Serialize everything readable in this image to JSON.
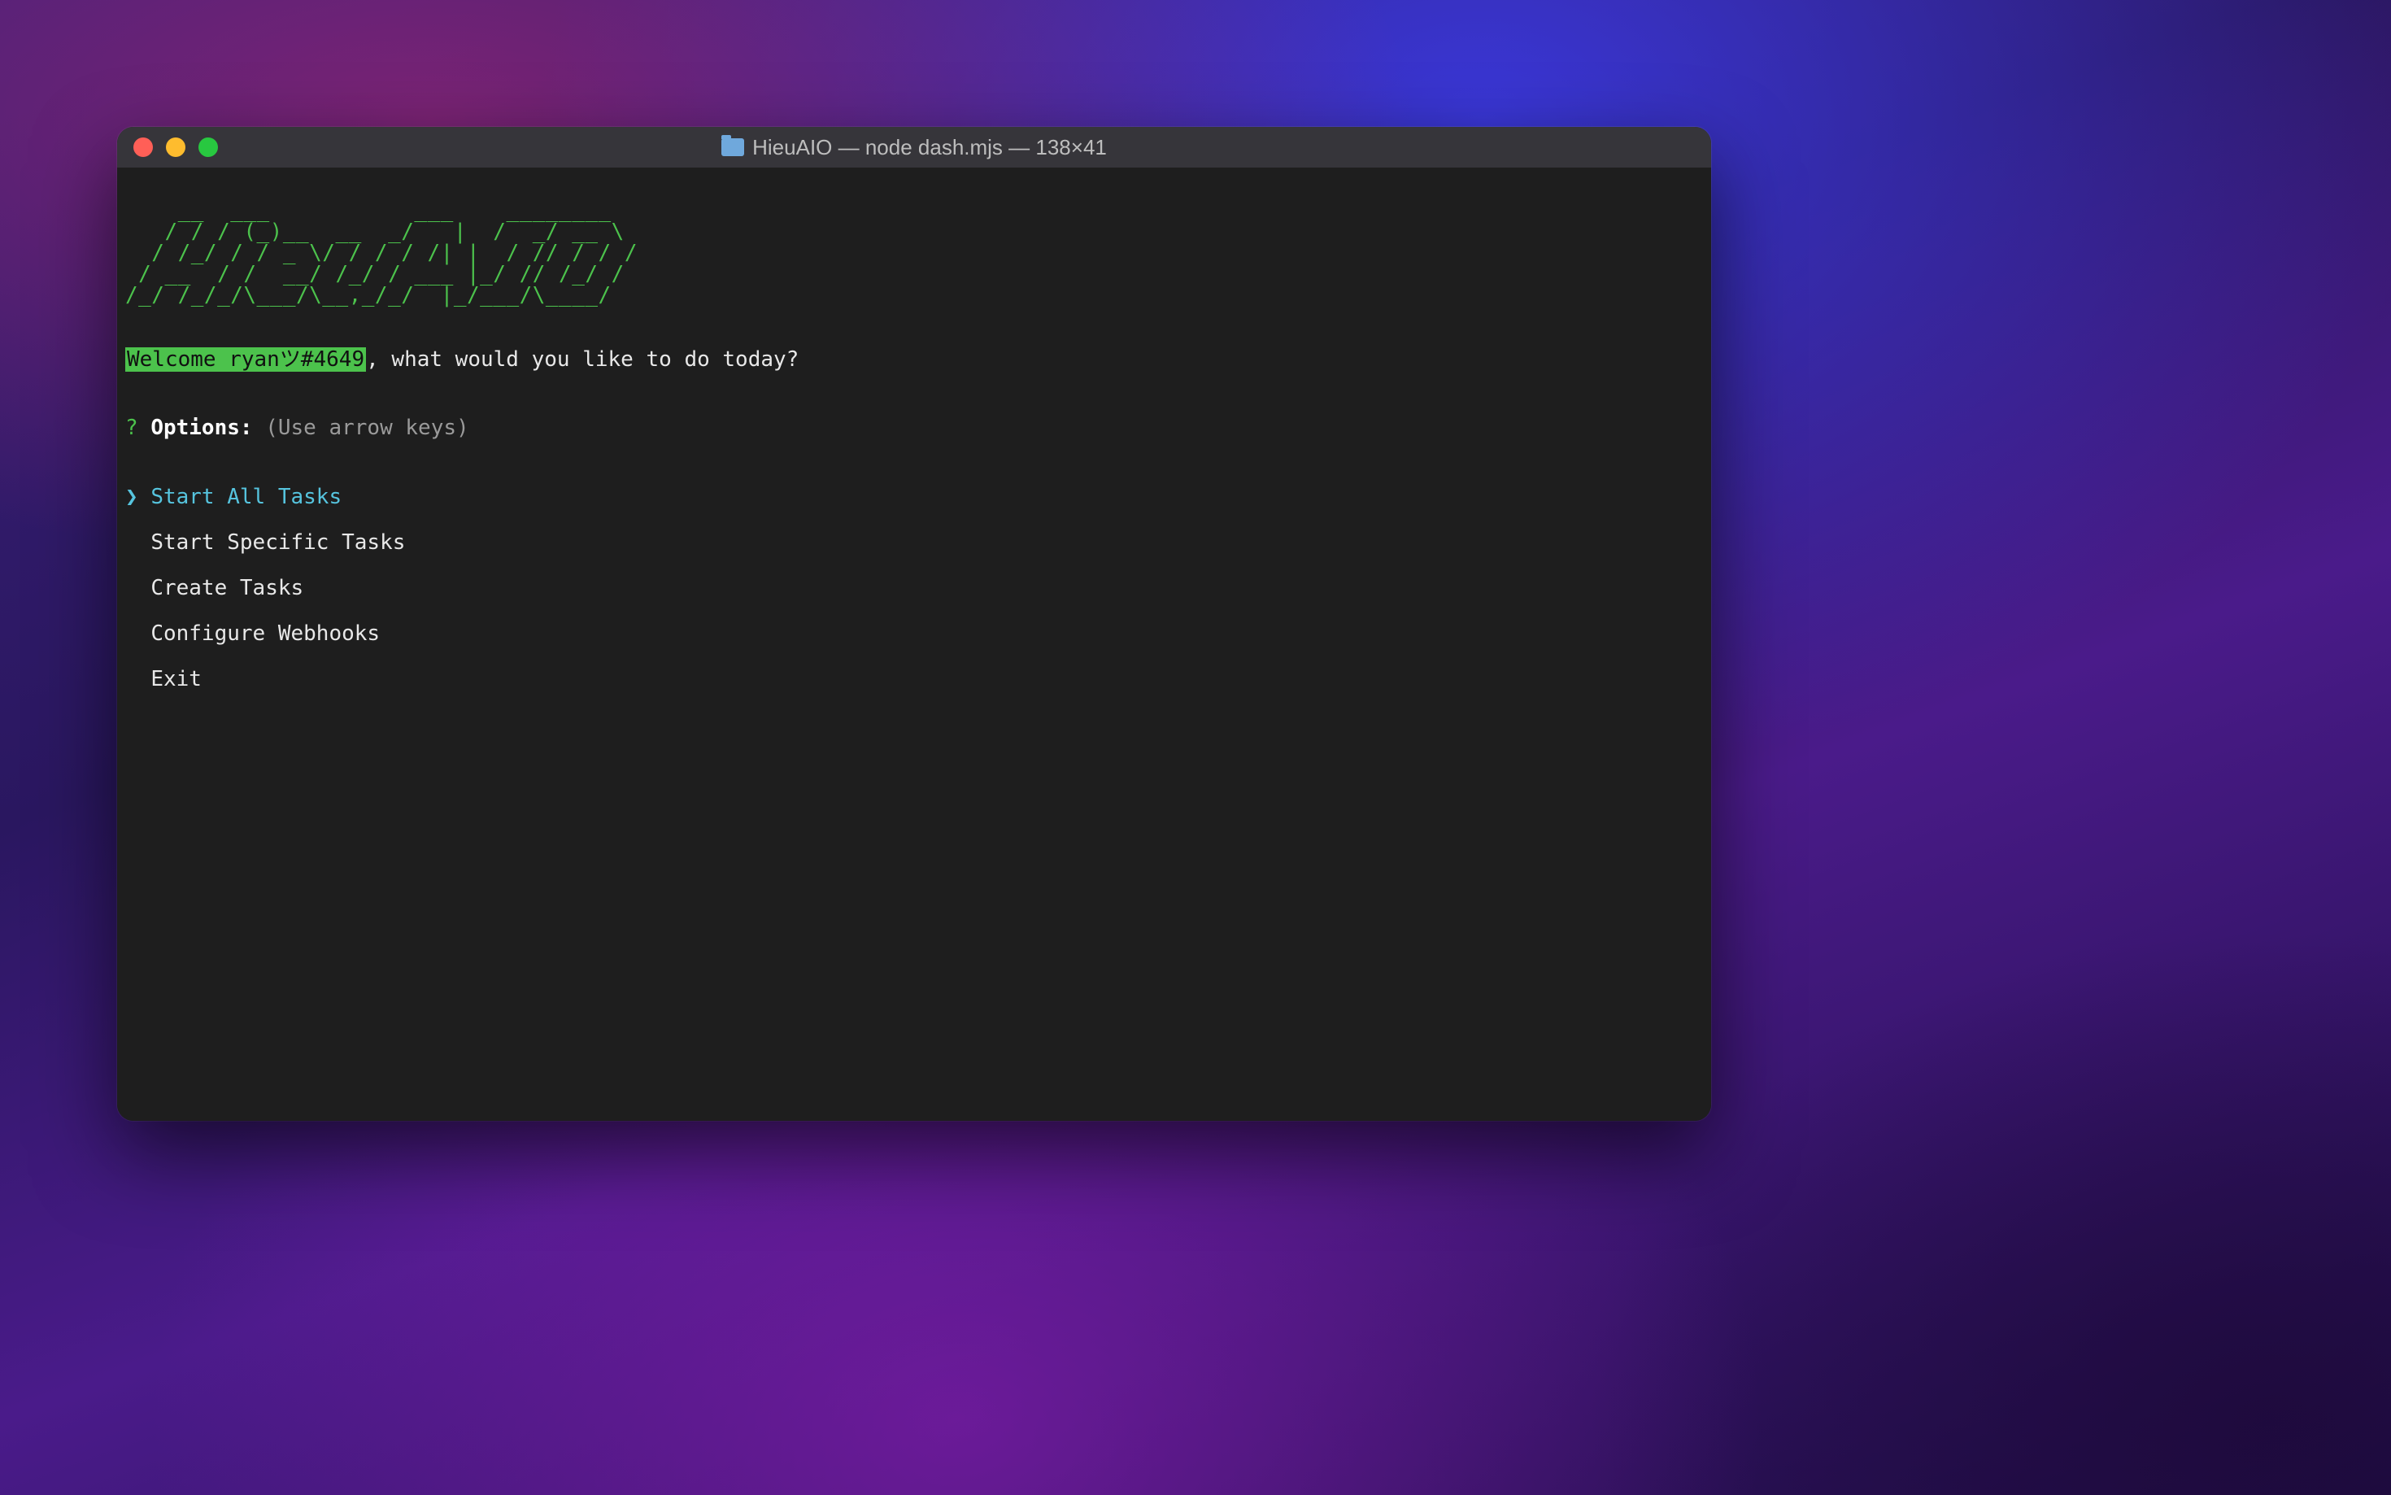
{
  "window": {
    "title": "HieuAIO — node dash.mjs — 138×41"
  },
  "ascii_art": "    __  ___           ___    ________ \n   / / / (_)__  __  _/   |  /  _/ __ \\\n  / /_/ / / _ \\/ / / / /| |  / // / / /\n / __  / /  __/ /_/ / ___ |_/ // /_/ / \n/_/ /_/_/\\___/\\__,_/_/  |_/___/\\____/  ",
  "welcome": {
    "highlight": "Welcome ryanツ#4649",
    "rest": ", what would you like to do today?"
  },
  "prompt": {
    "q": "?",
    "label": "Options:",
    "hint": "(Use arrow keys)"
  },
  "menu": {
    "pointer": "❯",
    "selected_index": 0,
    "items": [
      "Start All Tasks",
      "Start Specific Tasks",
      "Create Tasks",
      "Configure Webhooks",
      "Exit"
    ]
  }
}
